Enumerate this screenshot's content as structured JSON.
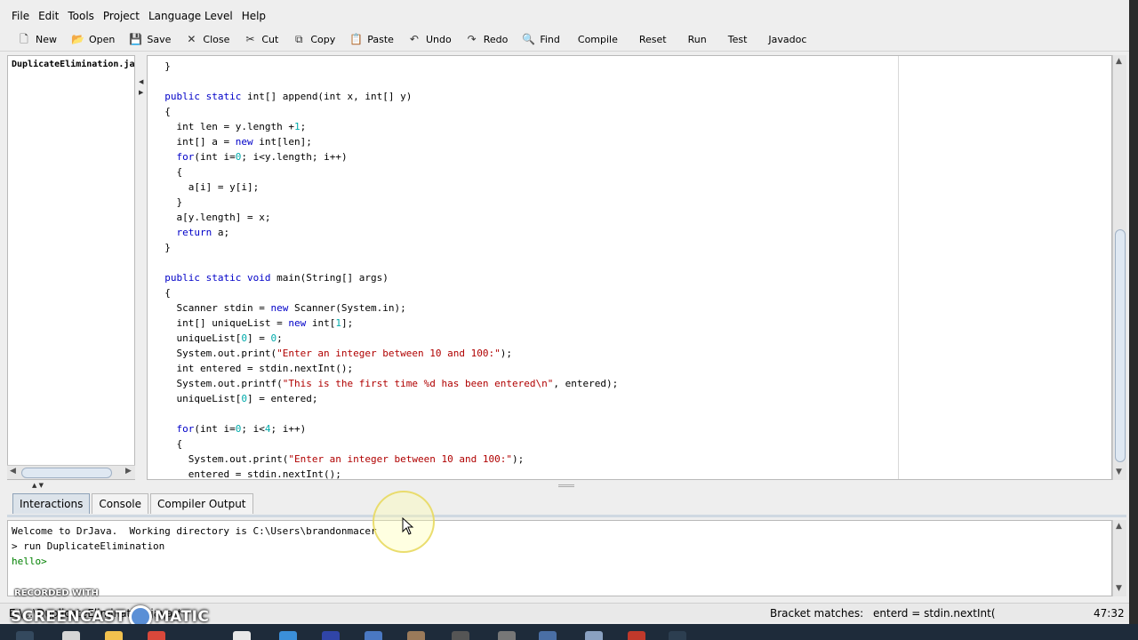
{
  "menu": [
    "File",
    "Edit",
    "Tools",
    "Project",
    "Language Level",
    "Help"
  ],
  "toolbar": [
    {
      "label": "New",
      "icon": "new-file-icon",
      "glyph": "🗋"
    },
    {
      "label": "Open",
      "icon": "open-folder-icon",
      "glyph": "📂"
    },
    {
      "label": "Save",
      "icon": "save-icon",
      "glyph": "💾"
    },
    {
      "label": "Close",
      "icon": "close-file-icon",
      "glyph": "✕"
    },
    {
      "label": "Cut",
      "icon": "scissors-icon",
      "glyph": "✂"
    },
    {
      "label": "Copy",
      "icon": "copy-icon",
      "glyph": "⧉"
    },
    {
      "label": "Paste",
      "icon": "clipboard-icon",
      "glyph": "📋"
    },
    {
      "label": "Undo",
      "icon": "undo-icon",
      "glyph": "↶"
    },
    {
      "label": "Redo",
      "icon": "redo-icon",
      "glyph": "↷"
    },
    {
      "label": "Find",
      "icon": "binoculars-icon",
      "glyph": "🔍"
    },
    {
      "label": "Compile",
      "icon": null,
      "glyph": ""
    },
    {
      "label": "Reset",
      "icon": null,
      "glyph": ""
    },
    {
      "label": "Run",
      "icon": null,
      "glyph": ""
    },
    {
      "label": "Test",
      "icon": null,
      "glyph": ""
    },
    {
      "label": "Javadoc",
      "icon": null,
      "glyph": ""
    }
  ],
  "file_list": [
    "DuplicateElimination.ja"
  ],
  "code_lines": [
    [
      [
        "tx",
        "  }"
      ]
    ],
    [
      [
        "tx",
        ""
      ]
    ],
    [
      [
        "tx",
        "  "
      ],
      [
        "kw",
        "public static"
      ],
      [
        "tx",
        " int[] append(int x, int[] y)"
      ]
    ],
    [
      [
        "tx",
        "  {"
      ]
    ],
    [
      [
        "tx",
        "    int len = y.length +"
      ],
      [
        "num",
        "1"
      ],
      [
        "tx",
        ";"
      ]
    ],
    [
      [
        "tx",
        "    int[] a = "
      ],
      [
        "kw",
        "new"
      ],
      [
        "tx",
        " int[len];"
      ]
    ],
    [
      [
        "tx",
        "    "
      ],
      [
        "kw",
        "for"
      ],
      [
        "tx",
        "(int i="
      ],
      [
        "num",
        "0"
      ],
      [
        "tx",
        "; i<y.length; i++)"
      ]
    ],
    [
      [
        "tx",
        "    {"
      ]
    ],
    [
      [
        "tx",
        "      a[i] = y[i];"
      ]
    ],
    [
      [
        "tx",
        "    }"
      ]
    ],
    [
      [
        "tx",
        "    a[y.length] = x;"
      ]
    ],
    [
      [
        "tx",
        "    "
      ],
      [
        "kw",
        "return"
      ],
      [
        "tx",
        " a;"
      ]
    ],
    [
      [
        "tx",
        "  }"
      ]
    ],
    [
      [
        "tx",
        ""
      ]
    ],
    [
      [
        "tx",
        "  "
      ],
      [
        "kw",
        "public static void"
      ],
      [
        "tx",
        " main(String[] args)"
      ]
    ],
    [
      [
        "tx",
        "  {"
      ]
    ],
    [
      [
        "tx",
        "    Scanner stdin = "
      ],
      [
        "kw",
        "new"
      ],
      [
        "tx",
        " Scanner(System.in);"
      ]
    ],
    [
      [
        "tx",
        "    int[] uniqueList = "
      ],
      [
        "kw",
        "new"
      ],
      [
        "tx",
        " int["
      ],
      [
        "num",
        "1"
      ],
      [
        "tx",
        "];"
      ]
    ],
    [
      [
        "tx",
        "    uniqueList["
      ],
      [
        "num",
        "0"
      ],
      [
        "tx",
        "] = "
      ],
      [
        "num",
        "0"
      ],
      [
        "tx",
        ";"
      ]
    ],
    [
      [
        "tx",
        "    System.out.print("
      ],
      [
        "str",
        "\"Enter an integer between 10 and 100:\""
      ],
      [
        "tx",
        ");"
      ]
    ],
    [
      [
        "tx",
        "    int entered = stdin.nextInt();"
      ]
    ],
    [
      [
        "tx",
        "    System.out.printf("
      ],
      [
        "str",
        "\"This is the first time %d has been entered\\n\""
      ],
      [
        "tx",
        ", entered);"
      ]
    ],
    [
      [
        "tx",
        "    uniqueList["
      ],
      [
        "num",
        "0"
      ],
      [
        "tx",
        "] = entered;"
      ]
    ],
    [
      [
        "tx",
        ""
      ]
    ],
    [
      [
        "tx",
        "    "
      ],
      [
        "kw",
        "for"
      ],
      [
        "tx",
        "(int i="
      ],
      [
        "num",
        "0"
      ],
      [
        "tx",
        "; i<"
      ],
      [
        "num",
        "4"
      ],
      [
        "tx",
        "; i++)"
      ]
    ],
    [
      [
        "tx",
        "    {"
      ]
    ],
    [
      [
        "tx",
        "      System.out.print("
      ],
      [
        "str",
        "\"Enter an integer between 10 and 100:\""
      ],
      [
        "tx",
        ");"
      ]
    ],
    [
      [
        "tx",
        "      entered = stdin.nextInt();"
      ]
    ]
  ],
  "tabs": [
    {
      "label": "Interactions",
      "active": true
    },
    {
      "label": "Console",
      "active": false
    },
    {
      "label": "Compiler Output",
      "active": false
    }
  ],
  "interactions": {
    "welcome": "Welcome to DrJava.  Working directory is C:\\Users\\brandonmacer",
    "command": "> run DuplicateElimination",
    "output": "hello>"
  },
  "statusbar": {
    "file": "E:\\...\\DuplicateElimination.java *",
    "bracket_label": "Bracket matches:",
    "bracket_value": "enterd = stdin.nextInt(",
    "position": "47:32"
  },
  "watermark": {
    "small": "RECORDED WITH",
    "big_left": "SCREENCAST",
    "big_right": "MATIC"
  },
  "colors": {
    "keyword": "#0000c8",
    "number": "#00aaaa",
    "string": "#b00000",
    "output": "#008000"
  }
}
